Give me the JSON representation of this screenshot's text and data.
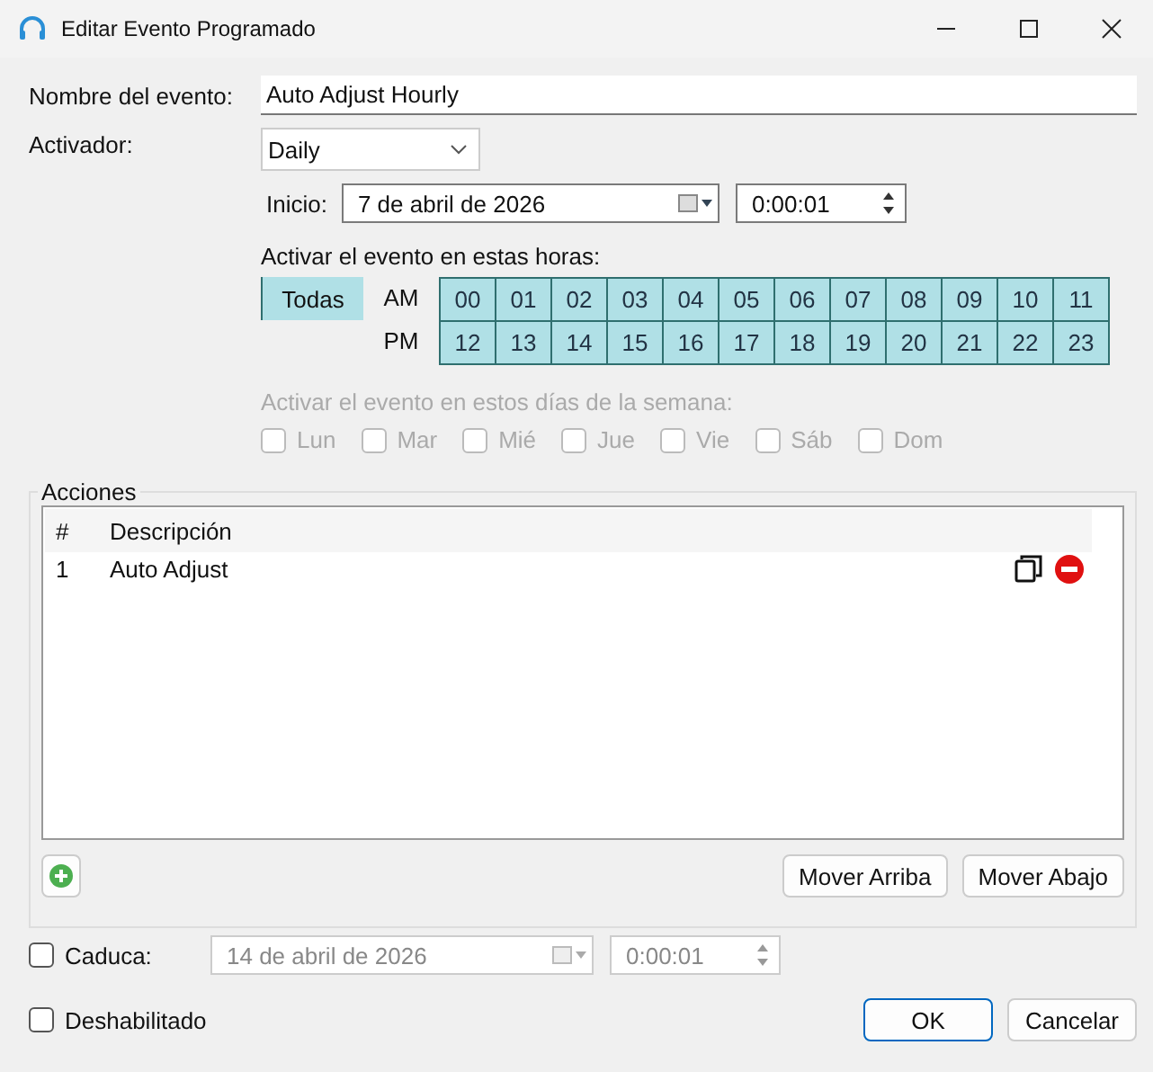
{
  "window": {
    "title": "Editar Evento Programado"
  },
  "name_field": {
    "label": "Nombre del evento:",
    "value": "Auto Adjust Hourly"
  },
  "trigger": {
    "label": "Activador:",
    "value": "Daily"
  },
  "start": {
    "label": "Inicio:",
    "date": "7 de abril de 2026",
    "time": "0:00:01"
  },
  "hours": {
    "label": "Activar el evento en estas horas:",
    "all_button": "Todas",
    "am_label": "AM",
    "pm_label": "PM",
    "am": [
      {
        "label": "00",
        "selected": true
      },
      {
        "label": "01",
        "selected": true
      },
      {
        "label": "02",
        "selected": true
      },
      {
        "label": "03",
        "selected": true
      },
      {
        "label": "04",
        "selected": true
      },
      {
        "label": "05",
        "selected": true
      },
      {
        "label": "06",
        "selected": true
      },
      {
        "label": "07",
        "selected": true
      },
      {
        "label": "08",
        "selected": true
      },
      {
        "label": "09",
        "selected": true
      },
      {
        "label": "10",
        "selected": true
      },
      {
        "label": "11",
        "selected": true
      }
    ],
    "pm": [
      {
        "label": "12",
        "selected": true
      },
      {
        "label": "13",
        "selected": true
      },
      {
        "label": "14",
        "selected": true
      },
      {
        "label": "15",
        "selected": true
      },
      {
        "label": "16",
        "selected": true
      },
      {
        "label": "17",
        "selected": true
      },
      {
        "label": "18",
        "selected": true
      },
      {
        "label": "19",
        "selected": true
      },
      {
        "label": "20",
        "selected": true
      },
      {
        "label": "21",
        "selected": true
      },
      {
        "label": "22",
        "selected": true
      },
      {
        "label": "23",
        "selected": true
      }
    ]
  },
  "days": {
    "label": "Activar el evento en estos días de la semana:",
    "disabled": true,
    "items": [
      {
        "label": "Lun",
        "checked": false
      },
      {
        "label": "Mar",
        "checked": false
      },
      {
        "label": "Mié",
        "checked": false
      },
      {
        "label": "Jue",
        "checked": false
      },
      {
        "label": "Vie",
        "checked": false
      },
      {
        "label": "Sáb",
        "checked": false
      },
      {
        "label": "Dom",
        "checked": false
      }
    ]
  },
  "actions": {
    "title": "Acciones",
    "columns": [
      "#",
      "Descripción"
    ],
    "rows": [
      {
        "index": "1",
        "description": "Auto Adjust"
      }
    ],
    "buttons": [
      "Mover Arriba",
      "Mover Abajo"
    ]
  },
  "expires": {
    "label": "Caduca:",
    "checked": false,
    "date": "14 de abril de 2026",
    "time": "0:00:01"
  },
  "disabled_option": {
    "label": "Deshabilitado",
    "checked": false
  },
  "buttons": [
    "OK",
    "Cancelar"
  ]
}
